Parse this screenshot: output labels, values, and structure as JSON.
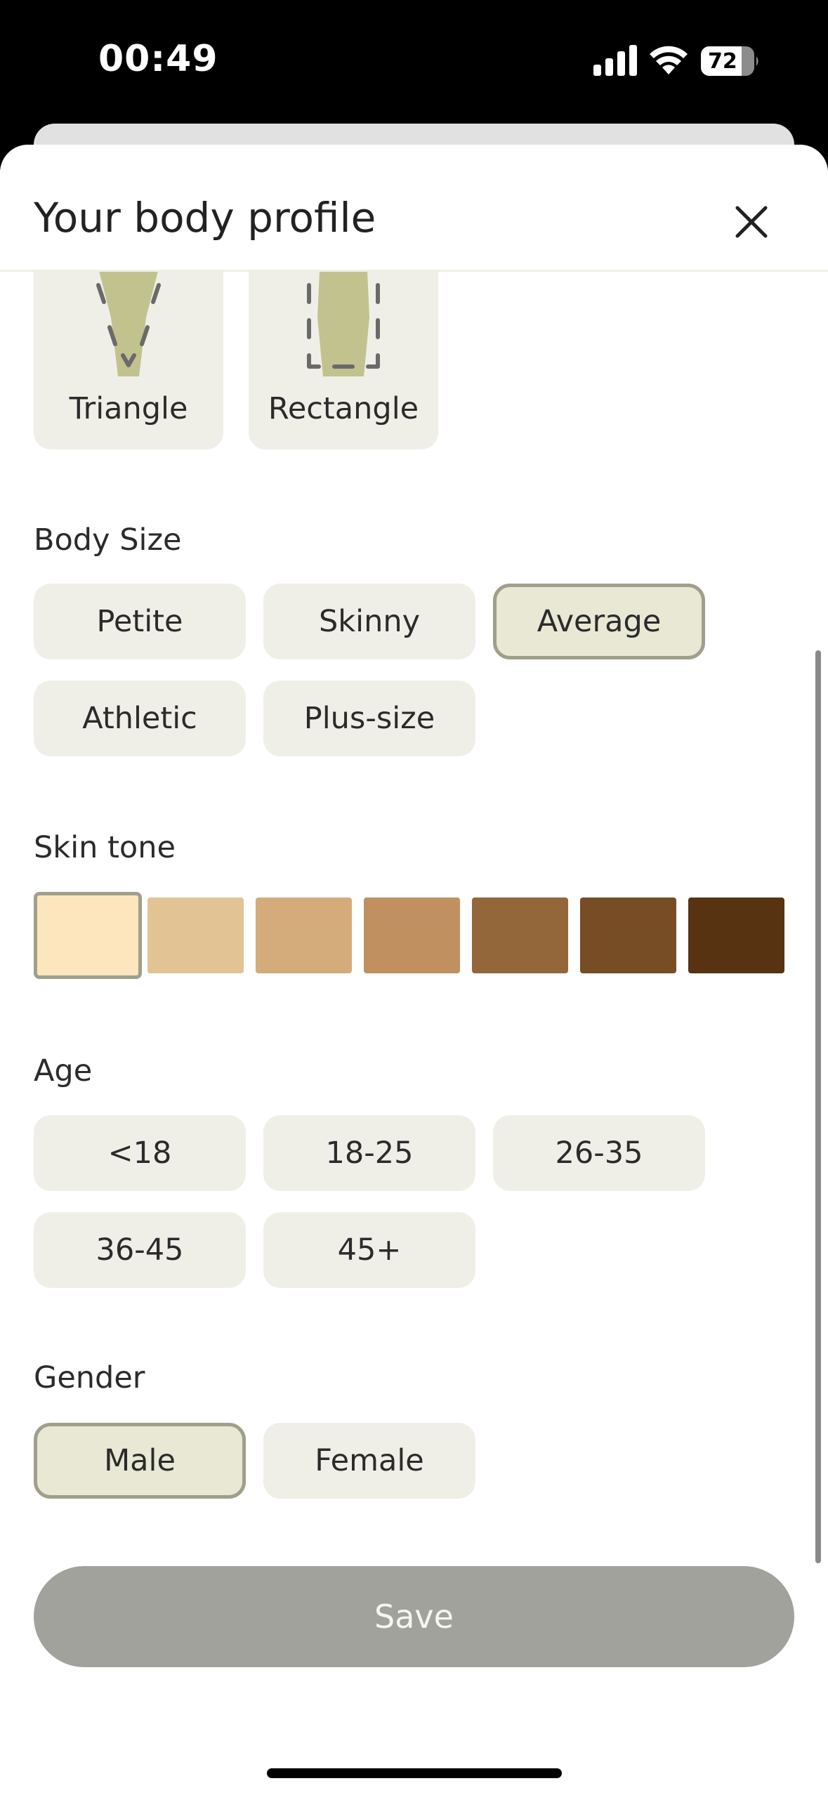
{
  "status_bar": {
    "time": "00:49",
    "battery_level": "72",
    "signal_icon": "cellular-signal-icon",
    "wifi_icon": "wifi-icon",
    "battery_icon": "battery-icon"
  },
  "sheet": {
    "title": "Your body profile",
    "close_icon": "close-icon"
  },
  "body_shape": {
    "options": [
      {
        "label": "Triangle",
        "icon": "triangle-body-shape-icon"
      },
      {
        "label": "Rectangle",
        "icon": "rectangle-body-shape-icon"
      }
    ]
  },
  "body_size": {
    "label": "Body Size",
    "options": [
      "Petite",
      "Skinny",
      "Average",
      "Athletic",
      "Plus-size"
    ],
    "selected": "Average"
  },
  "skin_tone": {
    "label": "Skin tone",
    "swatches": [
      "#fde6bd",
      "#e2c393",
      "#d4ac7b",
      "#c19060",
      "#94673a",
      "#774d25",
      "#583312"
    ],
    "selected_index": 0
  },
  "age": {
    "label": "Age",
    "options": [
      "<18",
      "18-25",
      "26-35",
      "36-45",
      "45+"
    ]
  },
  "gender": {
    "label": "Gender",
    "options": [
      "Male",
      "Female"
    ],
    "selected": "Male"
  },
  "actions": {
    "save_label": "Save"
  },
  "colors": {
    "chip_background": "#f0efe7",
    "chip_selected_background": "#e8e8d5",
    "chip_selected_border": "#9f9f8c",
    "save_button": "#a1a29c",
    "shape_fill": "#c2c28f"
  }
}
